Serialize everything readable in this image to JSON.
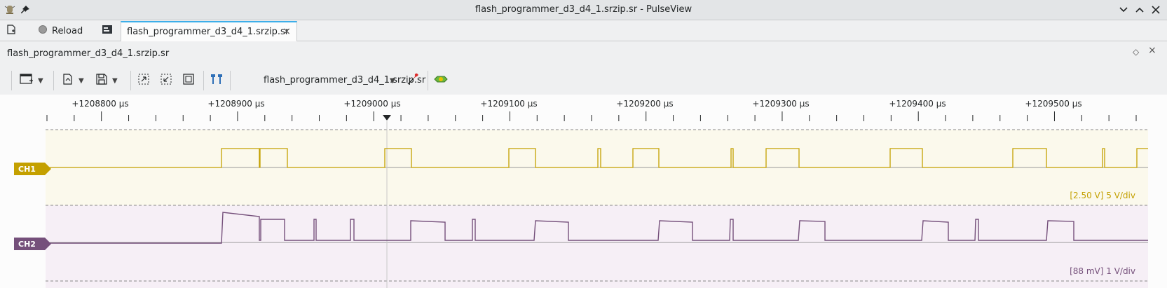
{
  "window": {
    "title": "flash_programmer_d3_d4_1.srzip.sr - PulseView"
  },
  "main_toolbar": {
    "reload_label": "Reload",
    "tab_label": "flash_programmer_d3_d4_1.srzip.sr",
    "tab_close": "×"
  },
  "dock": {
    "title": "flash_programmer_d3_d4_1.srzip.sr",
    "float_glyph": "◇",
    "close_glyph": "×"
  },
  "view_toolbar": {
    "session_label": "flash_programmer_d3_d4_1.srzip.sr"
  },
  "ruler": {
    "labels": [
      "+1208800 µs",
      "+1208900 µs",
      "+1209000 µs",
      "+1209100 µs",
      "+1209200 µs",
      "+1209300 µs",
      "+1209400 µs",
      "+1209500 µs"
    ]
  },
  "channels": [
    {
      "name": "CH1",
      "color": "#c4a000",
      "scale": "[2.50 V] 5 V/div"
    },
    {
      "name": "CH2",
      "color": "#75507b",
      "scale": "[88 mV] 1 V/div"
    }
  ],
  "icons": [
    "pin-icon",
    "app-icon",
    "new-session-icon",
    "reload-icon",
    "session-icon",
    "add-view-icon",
    "open-icon",
    "save-icon",
    "zoom-fit-icon",
    "zoom-one-icon",
    "zoom-full-icon",
    "cursor-icon",
    "probe-icon",
    "decoder-icon"
  ]
}
